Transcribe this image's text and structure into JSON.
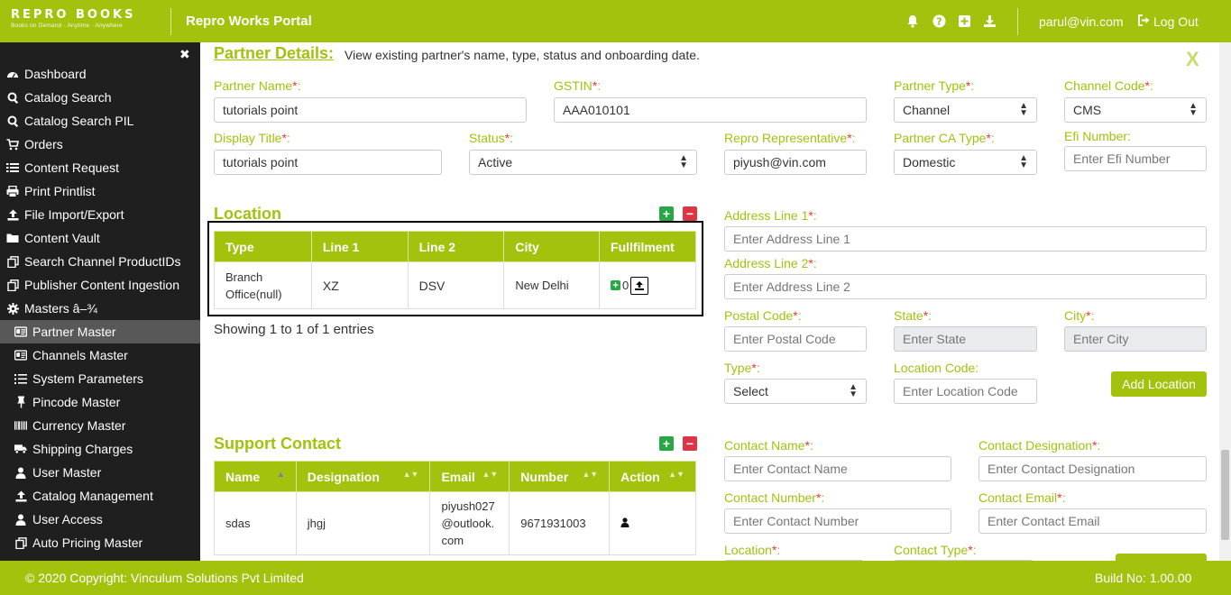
{
  "header": {
    "logo_text": "REPRO BOOKS",
    "logo_tagline": "Books on Demand · Anytime · Anywhere",
    "portal_title": "Repro Works Portal",
    "icons": [
      "bell-icon",
      "help-icon",
      "plus-square-icon",
      "download-icon"
    ],
    "user_email": "parul@vin.com",
    "logout_label": "Log Out"
  },
  "sidebar": {
    "close_glyph": "✖",
    "items": [
      {
        "label": "Dashboard",
        "icon": "dashboard-icon",
        "sub": false,
        "active": false
      },
      {
        "label": "Catalog Search",
        "icon": "search-icon",
        "sub": false,
        "active": false
      },
      {
        "label": "Catalog Search PIL",
        "icon": "search-icon",
        "sub": false,
        "active": false
      },
      {
        "label": "Orders",
        "icon": "cart-icon",
        "sub": false,
        "active": false
      },
      {
        "label": "Content Request",
        "icon": "list-icon",
        "sub": false,
        "active": false
      },
      {
        "label": "Print Printlist",
        "icon": "print-icon",
        "sub": false,
        "active": false
      },
      {
        "label": "File Import/Export",
        "icon": "upload-icon",
        "sub": false,
        "active": false
      },
      {
        "label": "Content Vault",
        "icon": "folder-icon",
        "sub": false,
        "active": false
      },
      {
        "label": "Search Channel ProductIDs",
        "icon": "copy-icon",
        "sub": false,
        "active": false
      },
      {
        "label": "Publisher Content Ingestion",
        "icon": "copy-icon",
        "sub": false,
        "active": false
      },
      {
        "label": "Masters â–¾",
        "icon": "gear-icon",
        "sub": false,
        "active": false
      },
      {
        "label": "Partner Master",
        "icon": "id-card-icon",
        "sub": true,
        "active": true
      },
      {
        "label": "Channels Master",
        "icon": "id-card-icon",
        "sub": true,
        "active": false
      },
      {
        "label": "System Parameters",
        "icon": "list-ol-icon",
        "sub": true,
        "active": false
      },
      {
        "label": "Pincode Master",
        "icon": "pin-icon",
        "sub": true,
        "active": false
      },
      {
        "label": "Currency Master",
        "icon": "barcode-icon",
        "sub": true,
        "active": false
      },
      {
        "label": "Shipping Charges",
        "icon": "truck-icon",
        "sub": true,
        "active": false
      },
      {
        "label": "User Master",
        "icon": "user-icon",
        "sub": true,
        "active": false
      },
      {
        "label": "Catalog Management",
        "icon": "upload-icon",
        "sub": true,
        "active": false
      },
      {
        "label": "User Access",
        "icon": "user-icon",
        "sub": true,
        "active": false
      },
      {
        "label": "Auto Pricing Master",
        "icon": "copy-icon",
        "sub": true,
        "active": false
      }
    ]
  },
  "partner_details": {
    "title": "Partner Details:",
    "description": "View existing partner's name, type, status and onboarding date.",
    "close_glyph": "X",
    "fields": {
      "partner_name": {
        "label": "Partner Name",
        "value": "tutorials point"
      },
      "gstin": {
        "label": "GSTIN",
        "value": "AAA010101"
      },
      "partner_type": {
        "label": "Partner Type",
        "value": "Channel"
      },
      "channel_code": {
        "label": "Channel Code",
        "value": "CMS"
      },
      "display_title": {
        "label": "Display Title",
        "value": "tutorials point"
      },
      "status": {
        "label": "Status",
        "value": "Active"
      },
      "repro_rep": {
        "label": "Repro Representative",
        "value": "piyush@vin.com"
      },
      "partner_ca_type": {
        "label": "Partner CA Type",
        "value": "Domestic"
      },
      "efi_number": {
        "label": "Efi Number:",
        "placeholder": "Enter Efi Number"
      }
    }
  },
  "location": {
    "title": "Location",
    "columns": [
      "Type",
      "Line 1",
      "Line 2",
      "City",
      "Fullfilment"
    ],
    "rows": [
      {
        "type": "Branch Office(null)",
        "line1": "XZ",
        "line2": "DSV",
        "city": "New Delhi",
        "fulfilment_count": "0"
      }
    ],
    "entries_text": "Showing 1 to 1 of 1 entries",
    "form": {
      "address1": {
        "label": "Address Line 1",
        "placeholder": "Enter Address Line 1"
      },
      "address2": {
        "label": "Address Line 2",
        "placeholder": "Enter Address Line 2"
      },
      "postal": {
        "label": "Postal Code",
        "placeholder": "Enter Postal Code"
      },
      "state": {
        "label": "State",
        "placeholder": "Enter State"
      },
      "city": {
        "label": "City",
        "placeholder": "Enter City"
      },
      "type": {
        "label": "Type",
        "value": "Select"
      },
      "location_code": {
        "label": "Location Code:",
        "placeholder": "Enter Location Code"
      },
      "add_button": "Add Location"
    }
  },
  "support_contact": {
    "title": "Support Contact",
    "columns": [
      "Name",
      "Designation",
      "Email",
      "Number",
      "Action"
    ],
    "rows": [
      {
        "name": "sdas",
        "designation": "jhgj",
        "email": "piyush027 @outlook. com",
        "number": "9671931003"
      }
    ],
    "form": {
      "contact_name": {
        "label": "Contact Name",
        "placeholder": "Enter Contact Name"
      },
      "contact_designation": {
        "label": "Contact Designation",
        "placeholder": "Enter Contact Designation"
      },
      "contact_number": {
        "label": "Contact Number",
        "placeholder": "Enter Contact Number"
      },
      "contact_email": {
        "label": "Contact Email",
        "placeholder": "Enter Contact Email"
      },
      "location": {
        "label": "Location"
      },
      "contact_type": {
        "label": "Contact Type"
      }
    }
  },
  "footer": {
    "copyright": "© 2020 Copyright: Vinculum Solutions Pvt Limited",
    "build": "Build No: 1.00.00"
  },
  "colors": {
    "brand": "#a2c20e",
    "sidebar_bg": "#1f1f1f",
    "required": "#e8383d"
  }
}
